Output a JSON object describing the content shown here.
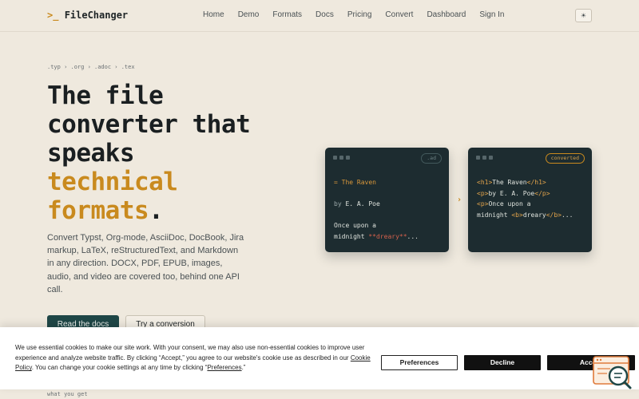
{
  "brand": {
    "prompt": ">_",
    "name": "FileChanger"
  },
  "nav": {
    "links": [
      "Home",
      "Demo",
      "Formats",
      "Docs",
      "Pricing",
      "Convert",
      "Dashboard",
      "Sign In"
    ],
    "theme_icon": "sun-icon"
  },
  "hero": {
    "extensions": ".typ › .org › .adoc › .tex",
    "title_line1": "The file",
    "title_line2": "converter that",
    "title_line3": "speaks",
    "title_accent1": "technical",
    "title_accent2": "formats",
    "title_period": ".",
    "description": "Convert Typst, Org-mode, AsciiDoc, DocBook, Jira markup, LaTeX, reStructuredText, and Markdown in any direction. DOCX, PDF, EPUB, images, audio, and video are covered too, behind one API call.",
    "cta_primary": "Read the docs",
    "cta_secondary": "Try a conversion"
  },
  "cards": {
    "source": {
      "badge": ".ad",
      "line1": "= The Raven",
      "line2_prefix": "by ",
      "line2_value": "E. A. Poe",
      "line3": "Once upon a",
      "line4_prefix": "midnight ",
      "line4_em": "**dreary**",
      "line4_suffix": "..."
    },
    "arrow": "›",
    "output": {
      "badge": "converted",
      "l1_open": "<h1>",
      "l1_text": "The Raven",
      "l1_close": "</h1>",
      "l2_open": "<p>",
      "l2_text": "by E. A. Poe",
      "l2_close": "</p>",
      "l3_open": "<p>",
      "l3_text": "Once upon a",
      "l4_text": "midnight ",
      "l4_open": "<b>",
      "l4_em": "dreary",
      "l4_close": "</b>",
      "l4_suffix": "..."
    }
  },
  "section_label": "what you get",
  "cookie": {
    "text_before_link": "We use essential cookies to make our site work. With your consent, we may also use non-essential cookies to improve user experience and analyze website traffic. By clicking “Accept,” you agree to our website's cookie use as described in our ",
    "policy_link": "Cookie Policy",
    "text_middle": ". You can change your cookie settings at any time by clicking “",
    "preferences_link": "Preferences",
    "text_end": ".”",
    "btn_preferences": "Preferences",
    "btn_decline": "Decline",
    "btn_accept": "Accept"
  },
  "colors": {
    "accent": "#c98a1e",
    "primary": "#1f4747",
    "card_bg": "#1d2c30",
    "page_bg": "#efe9de"
  }
}
